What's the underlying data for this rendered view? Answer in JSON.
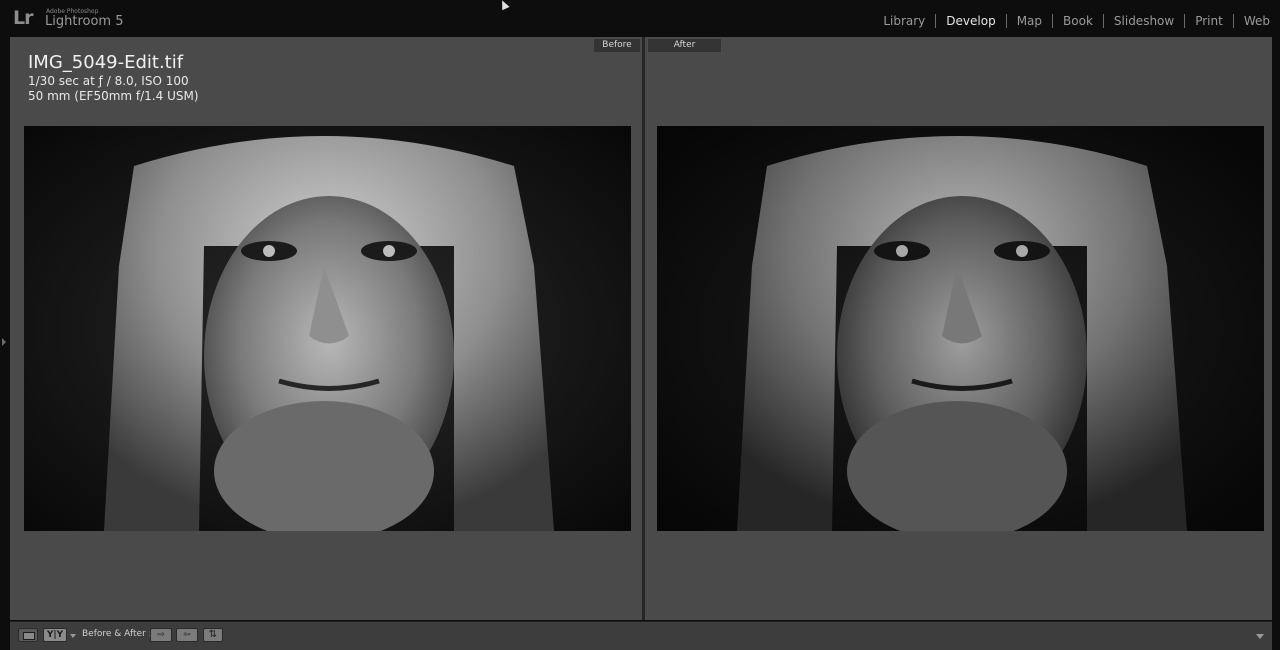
{
  "app": {
    "logo": "Lr",
    "vendor": "Adobe Photoshop",
    "name": "Lightroom 5"
  },
  "modules": [
    {
      "label": "Library",
      "active": false
    },
    {
      "label": "Develop",
      "active": true
    },
    {
      "label": "Map",
      "active": false
    },
    {
      "label": "Book",
      "active": false
    },
    {
      "label": "Slideshow",
      "active": false
    },
    {
      "label": "Print",
      "active": false
    },
    {
      "label": "Web",
      "active": false
    }
  ],
  "view": {
    "before_tag": "Before",
    "after_tag": "After"
  },
  "info": {
    "filename": "IMG_5049-Edit.tif",
    "exposure": "1/30 sec at ƒ / 8.0, ISO 100",
    "lens": "50 mm (EF50mm f/1.4 USM)"
  },
  "toolbar": {
    "view_mode": "Y|Y",
    "before_after_label": "Before & After :",
    "copy_before_to_after": "⇨",
    "copy_after_to_before": "⇦",
    "swap": "⇅"
  },
  "icons": {
    "loupe": "loupe-view-icon",
    "copy_right": "copy-before-to-after-icon",
    "copy_left": "copy-after-to-before-icon",
    "swap": "swap-before-after-icon"
  }
}
